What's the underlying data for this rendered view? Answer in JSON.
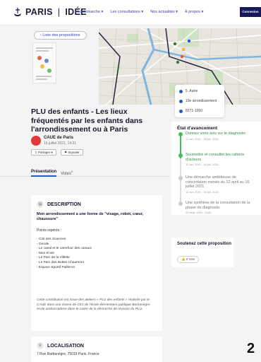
{
  "header": {
    "logo_text": "PARIS",
    "logo_text2": "IDÉE",
    "nav": [
      "La démarche ▾",
      "Les consultations ▾",
      "Nos actualités ▾",
      "À propos ▾"
    ],
    "connexion": "Connexion"
  },
  "back_label": "‹ Liste des propositions",
  "info": {
    "category": "5. Autre",
    "district": "19e arrondissement",
    "reference": "8271-1050"
  },
  "proposal": {
    "title": "PLU des enfants - Les lieux fréquentés par les enfants dans l'arrondissement ou à Paris",
    "author": "CAUE de Paris",
    "date": "15 juillet 2021, 14:21",
    "share_label": "Partager ▾",
    "report_label": "Signaler"
  },
  "progress": {
    "title": "État d'avancement",
    "steps": [
      {
        "text": "Donnez votre avis sur le diagnostic",
        "date": "12 avr. 2021 - 16 juil. 2021"
      },
      {
        "text": "Soumettre et consulter les cahiers d'acteurs",
        "date": "12 avr. 2021 - 16 juil. 2021"
      },
      {
        "text": "Une démarche ambitieuse de concertation menée du 12 avril au 16 juillet 2021",
        "date": "12 avr. 2021 - 16 juil. 2021"
      },
      {
        "text": "Une synthèse de la consultation de la phase de diagnostic",
        "date": "20 sept. 2021, 12:00"
      }
    ]
  },
  "support": {
    "title": "Soutenez cette proposition",
    "votes": "0 vote"
  },
  "tabs": {
    "presentation": "Présentation",
    "votes": "Votes",
    "votes_count": "0"
  },
  "description": {
    "heading": "DESCRIPTION",
    "lead": "Mon arrondissement a une forme de \"visage, robot, cœur, chaussure\"",
    "sub": "Points repérés :",
    "items": [
      "- Cité des Sciences",
      "- Geode",
      "- Le canal et le carrefour des canaux",
      "- Mon école",
      "- Le Parc de la Villette",
      "- Le Parc des Buttes Chaumont",
      "- Espace Sportif Pailleron"
    ],
    "footer": "Cette contribution est issue des ateliers « PLU des enfants » réalisée par le CAUE dans une classe de CE1 de l'école élémentaire publique Barbanègre, école ambassadrice dans le cadre de la démarche de révision du PLU."
  },
  "location": {
    "heading": "LOCALISATION",
    "address": "7 Rue Barbanègre, 75019 Paris, France"
  },
  "page_number": "2",
  "colors": {
    "accent": "#2b58c9",
    "brand_dark": "#17175c",
    "success": "#3dbf5a",
    "avatar": "#e03a3a"
  }
}
